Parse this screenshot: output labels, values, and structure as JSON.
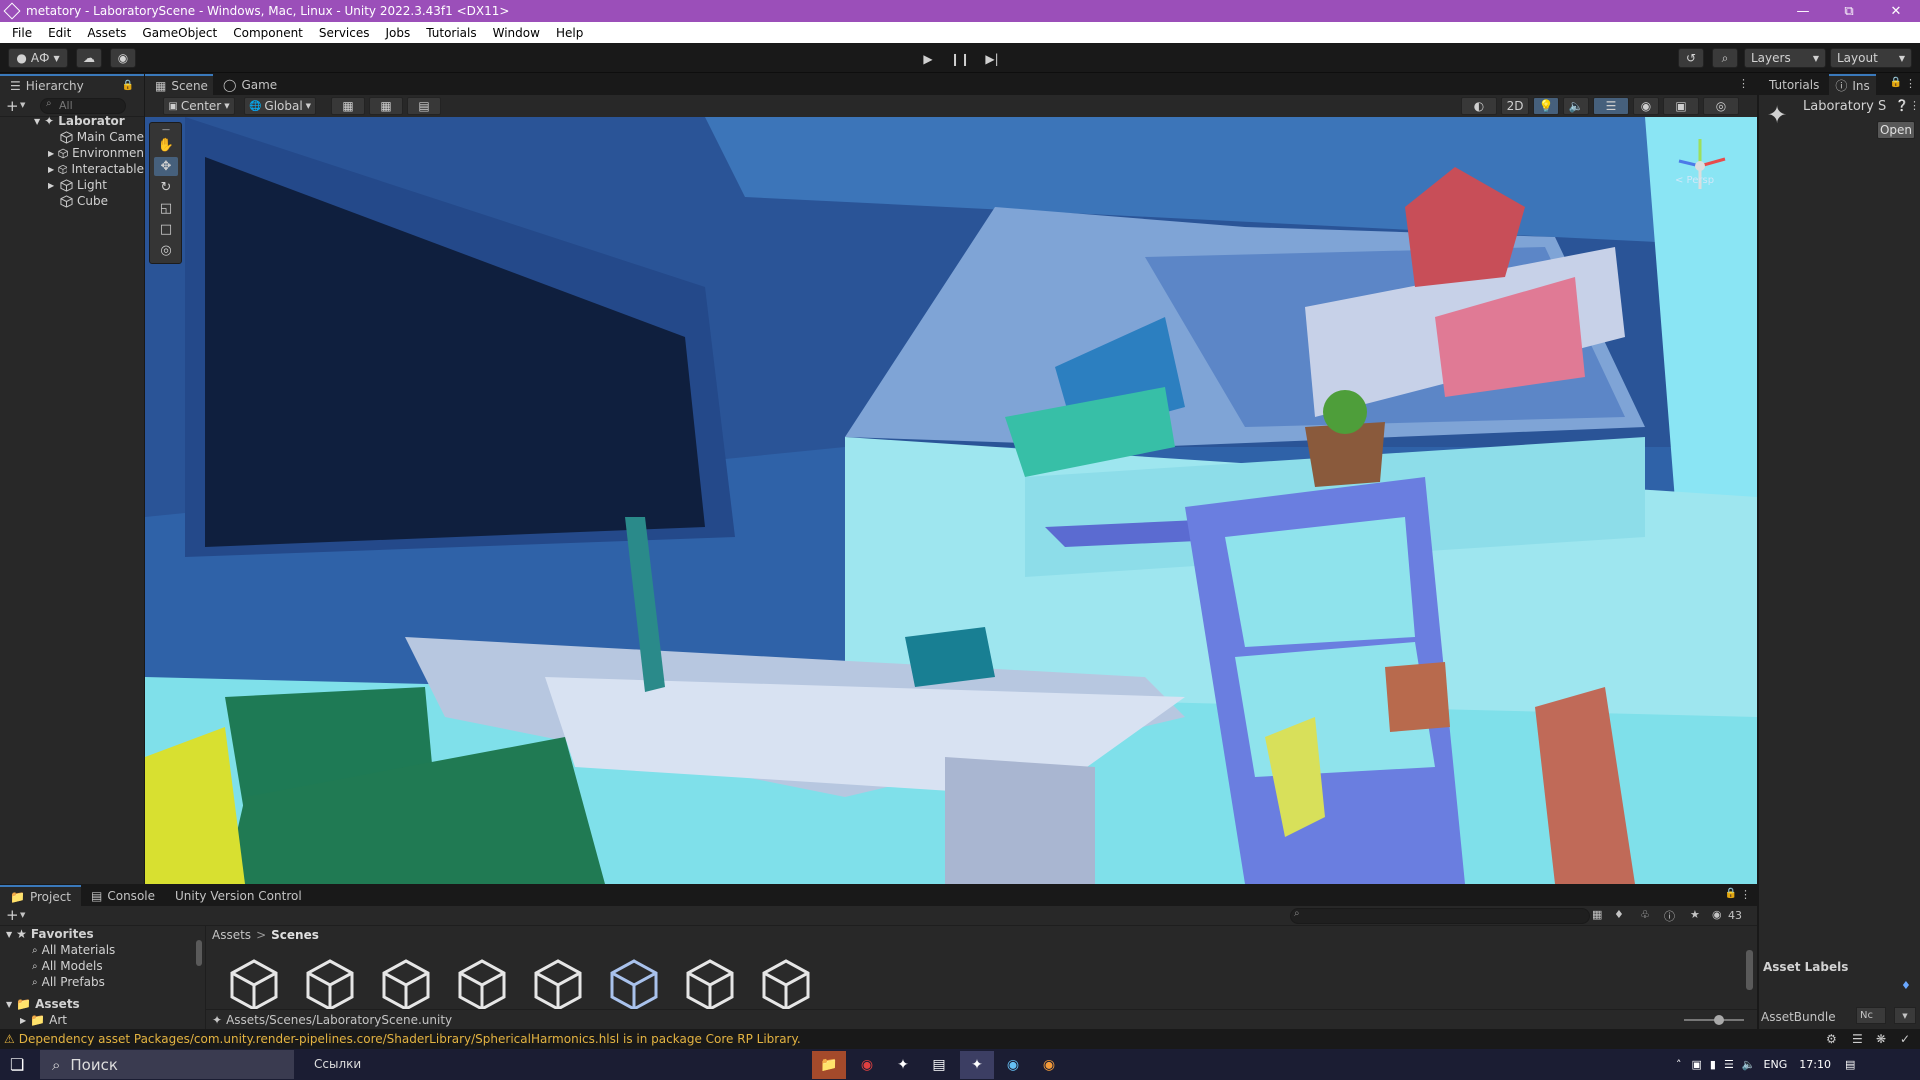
{
  "window": {
    "title": "metatory - LaboratoryScene - Windows, Mac, Linux - Unity 2022.3.43f1 <DX11>",
    "controls": [
      "—",
      "⧉",
      "✕"
    ]
  },
  "menu": [
    "File",
    "Edit",
    "Assets",
    "GameObject",
    "Component",
    "Services",
    "Jobs",
    "Tutorials",
    "Window",
    "Help"
  ],
  "toolbar": {
    "account_label": "АФ",
    "layers_label": "Layers",
    "layout_label": "Layout"
  },
  "hierarchy": {
    "tab_label": "Hierarchy",
    "search_placeholder": "All",
    "scene_name": "Laborator",
    "items": [
      "Main Came",
      "Environmen",
      "Interactable",
      "Light",
      "Cube"
    ]
  },
  "scene": {
    "tabs": [
      "Scene",
      "Game"
    ],
    "pivot_label": "Center",
    "space_label": "Global",
    "mode_2d_label": "2D",
    "gizmo_label": "< Persp"
  },
  "right_panel": {
    "tabs": [
      "Tutorials",
      "Ins"
    ],
    "asset_name": "Laboratory S",
    "open_label": "Open",
    "asset_labels_title": "Asset Labels",
    "asset_bundle_label": "AssetBundle",
    "asset_bundle_value": "Nc"
  },
  "project": {
    "tabs": [
      "Project",
      "Console",
      "Unity Version Control"
    ],
    "favorites_label": "Favorites",
    "favorites": [
      "All Materials",
      "All Models",
      "All Prefabs"
    ],
    "assets_root": "Assets",
    "assets_child": "Art",
    "breadcrumb": [
      "Assets",
      "Scenes"
    ],
    "breadcrumb_sep": ">",
    "selected_path": "Assets/Scenes/LaboratoryScene.unity",
    "hidden_count": "43"
  },
  "status": {
    "message": "Dependency asset Packages/com.unity.render-pipelines.core/ShaderLibrary/SphericalHarmonics.hlsl is in package Core RP Library."
  },
  "taskbar": {
    "search_label": "Поиск",
    "links_label": "Ссылки",
    "lang": "ENG",
    "time": "17:10"
  },
  "colors": {
    "title_bar": "#9b4fb9",
    "panel_bg": "#282828",
    "dark_bg": "#191919",
    "tab_accent": "#3a79bb",
    "warning": "#e3b341",
    "taskbar": "#1b1d33"
  }
}
